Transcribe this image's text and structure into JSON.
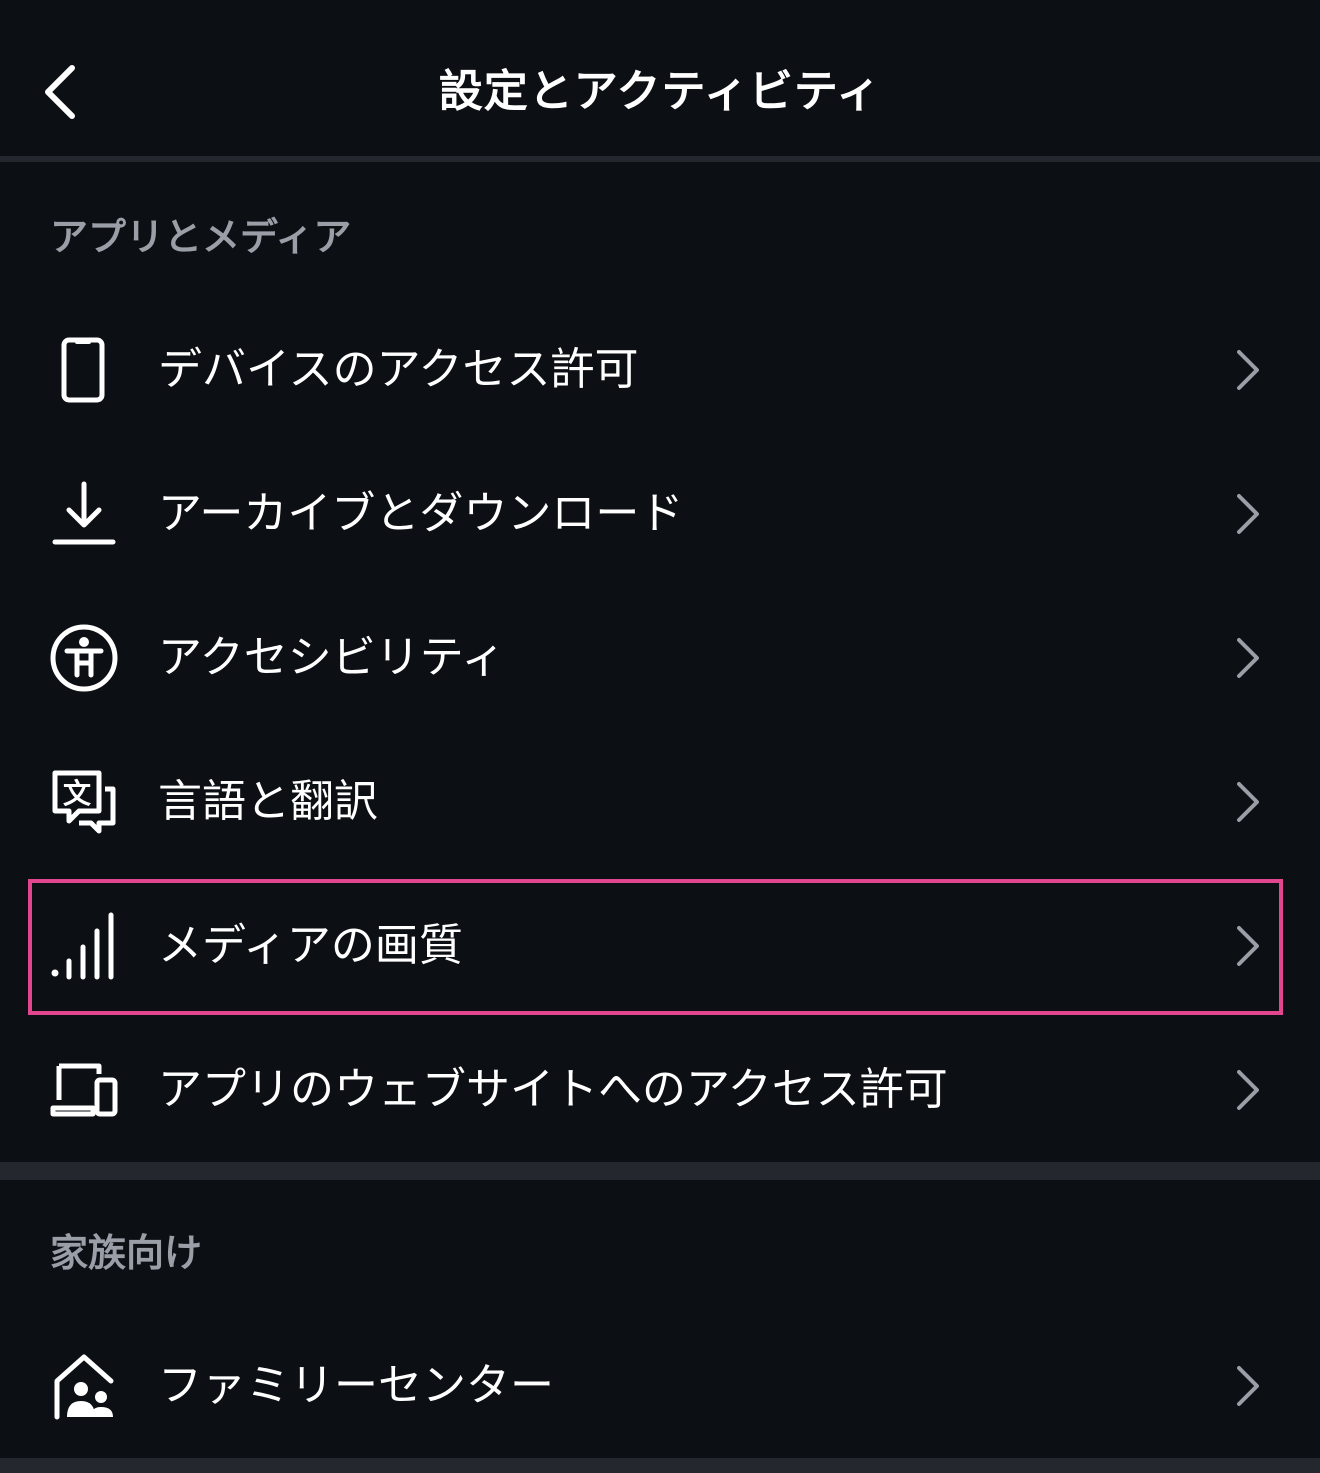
{
  "header": {
    "title": "設定とアクティビティ",
    "back_icon": "chevron-left-icon"
  },
  "sections": [
    {
      "title": "アプリとメディア",
      "items": [
        {
          "label": "デバイスのアクセス許可",
          "icon": "phone-icon"
        },
        {
          "label": "アーカイブとダウンロード",
          "icon": "download-icon"
        },
        {
          "label": "アクセシビリティ",
          "icon": "accessibility-icon"
        },
        {
          "label": "言語と翻訳",
          "icon": "translate-icon"
        },
        {
          "label": "メディアの画質",
          "icon": "signal-bars-icon",
          "highlighted": true
        },
        {
          "label": "アプリのウェブサイトへのアクセス許可",
          "icon": "laptop-phone-icon"
        }
      ]
    },
    {
      "title": "家族向け",
      "items": [
        {
          "label": "ファミリーセンター",
          "icon": "family-home-icon"
        }
      ]
    }
  ],
  "colors": {
    "background": "#0c0f14",
    "divider": "#24272e",
    "section_text": "#9a9ea6",
    "highlight": "#e2468f",
    "chevron": "#9a9ea6"
  }
}
